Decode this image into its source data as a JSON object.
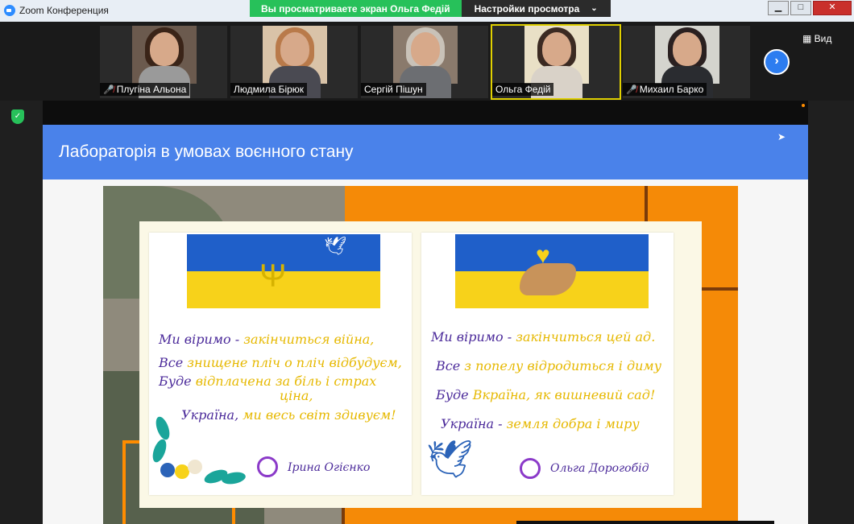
{
  "window": {
    "title": "Zoom Конференция",
    "share_banner": "Вы просматриваете экран Ольга Федій",
    "view_settings": "Настройки просмотра",
    "minimize": "▁",
    "maximize": "□",
    "close": "✕"
  },
  "participants": [
    {
      "name": "Плугіна Альона",
      "muted": true,
      "active": false
    },
    {
      "name": "Людмила Бірюк",
      "muted": false,
      "active": false
    },
    {
      "name": "Сергій Пішун",
      "muted": false,
      "active": false
    },
    {
      "name": "Ольга Федій",
      "muted": false,
      "active": true
    },
    {
      "name": "Михаил Барко",
      "muted": true,
      "active": false
    }
  ],
  "controls": {
    "next_label": "›",
    "view_label": "Вид",
    "mute_icon": "mic-off-icon",
    "shield_icon": "encryption-shield-icon"
  },
  "slide": {
    "title": "Лабораторія в умовах воєнного стану",
    "left_card": {
      "lines": [
        {
          "lead": "Ми віримо - ",
          "rest": "закінчиться війна,"
        },
        {
          "lead": "Все ",
          "rest": "знищене пліч о пліч відбудуєм,"
        },
        {
          "lead": "Буде ",
          "rest": "відплачена за біль і страх"
        },
        {
          "lead": "",
          "rest": "ціна,"
        },
        {
          "lead": "Україна, ",
          "rest": "ми весь світ здивуєм!"
        }
      ],
      "signature": "Ірина Огієнко"
    },
    "right_card": {
      "lines": [
        {
          "lead": "Ми віримо - ",
          "rest": "закінчиться цей ад."
        },
        {
          "lead": "Все ",
          "rest": "з попелу відродиться і диму"
        },
        {
          "lead": "Буде ",
          "rest": "Вкраїна, як вишневий сад!"
        },
        {
          "lead": "Україна - ",
          "rest": "земля добра і миру"
        }
      ],
      "signature": "Ольга Дорогобід"
    }
  },
  "colors": {
    "share_green": "#27c15a",
    "slide_header": "#4a82ea",
    "flag_blue": "#1f5fc9",
    "flag_yellow": "#f7d21a",
    "poster_orange": "#f58a07",
    "verse_purple": "#4b2a9a",
    "verse_yellow": "#e6b800"
  }
}
